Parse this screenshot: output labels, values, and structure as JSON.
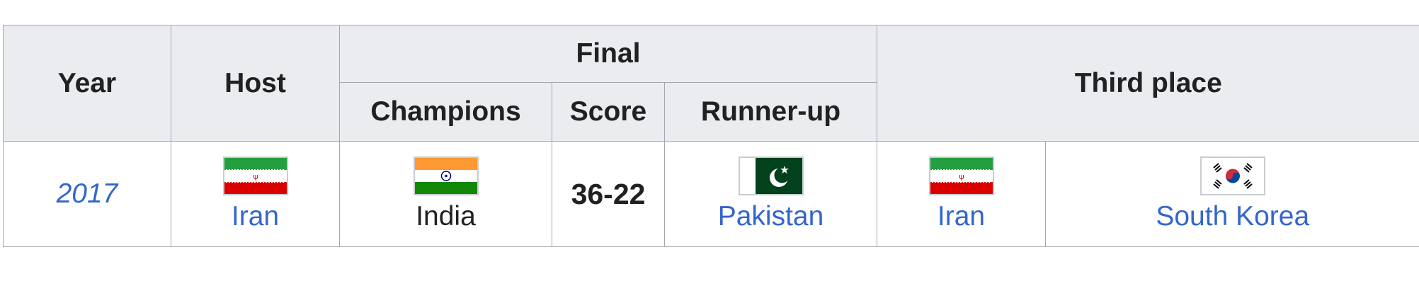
{
  "table": {
    "headers": {
      "year": "Year",
      "host": "Host",
      "final": "Final",
      "champions": "Champions",
      "score": "Score",
      "runner_up": "Runner-up",
      "third_place": "Third place"
    },
    "rows": [
      {
        "year": "2017",
        "host": {
          "name": "Iran",
          "flag": "iran-flag-icon"
        },
        "champion": {
          "name": "India",
          "flag": "india-flag-icon"
        },
        "score": "36-22",
        "runner_up": {
          "name": "Pakistan",
          "flag": "pakistan-flag-icon"
        },
        "third_place": [
          {
            "name": "Iran",
            "flag": "iran-flag-icon"
          },
          {
            "name": "South Korea",
            "flag": "south-korea-flag-icon"
          }
        ]
      }
    ]
  },
  "colors": {
    "header_bg": "#eaecf0",
    "border": "#a2a9b1",
    "link": "#3366cc",
    "text": "#202122"
  }
}
